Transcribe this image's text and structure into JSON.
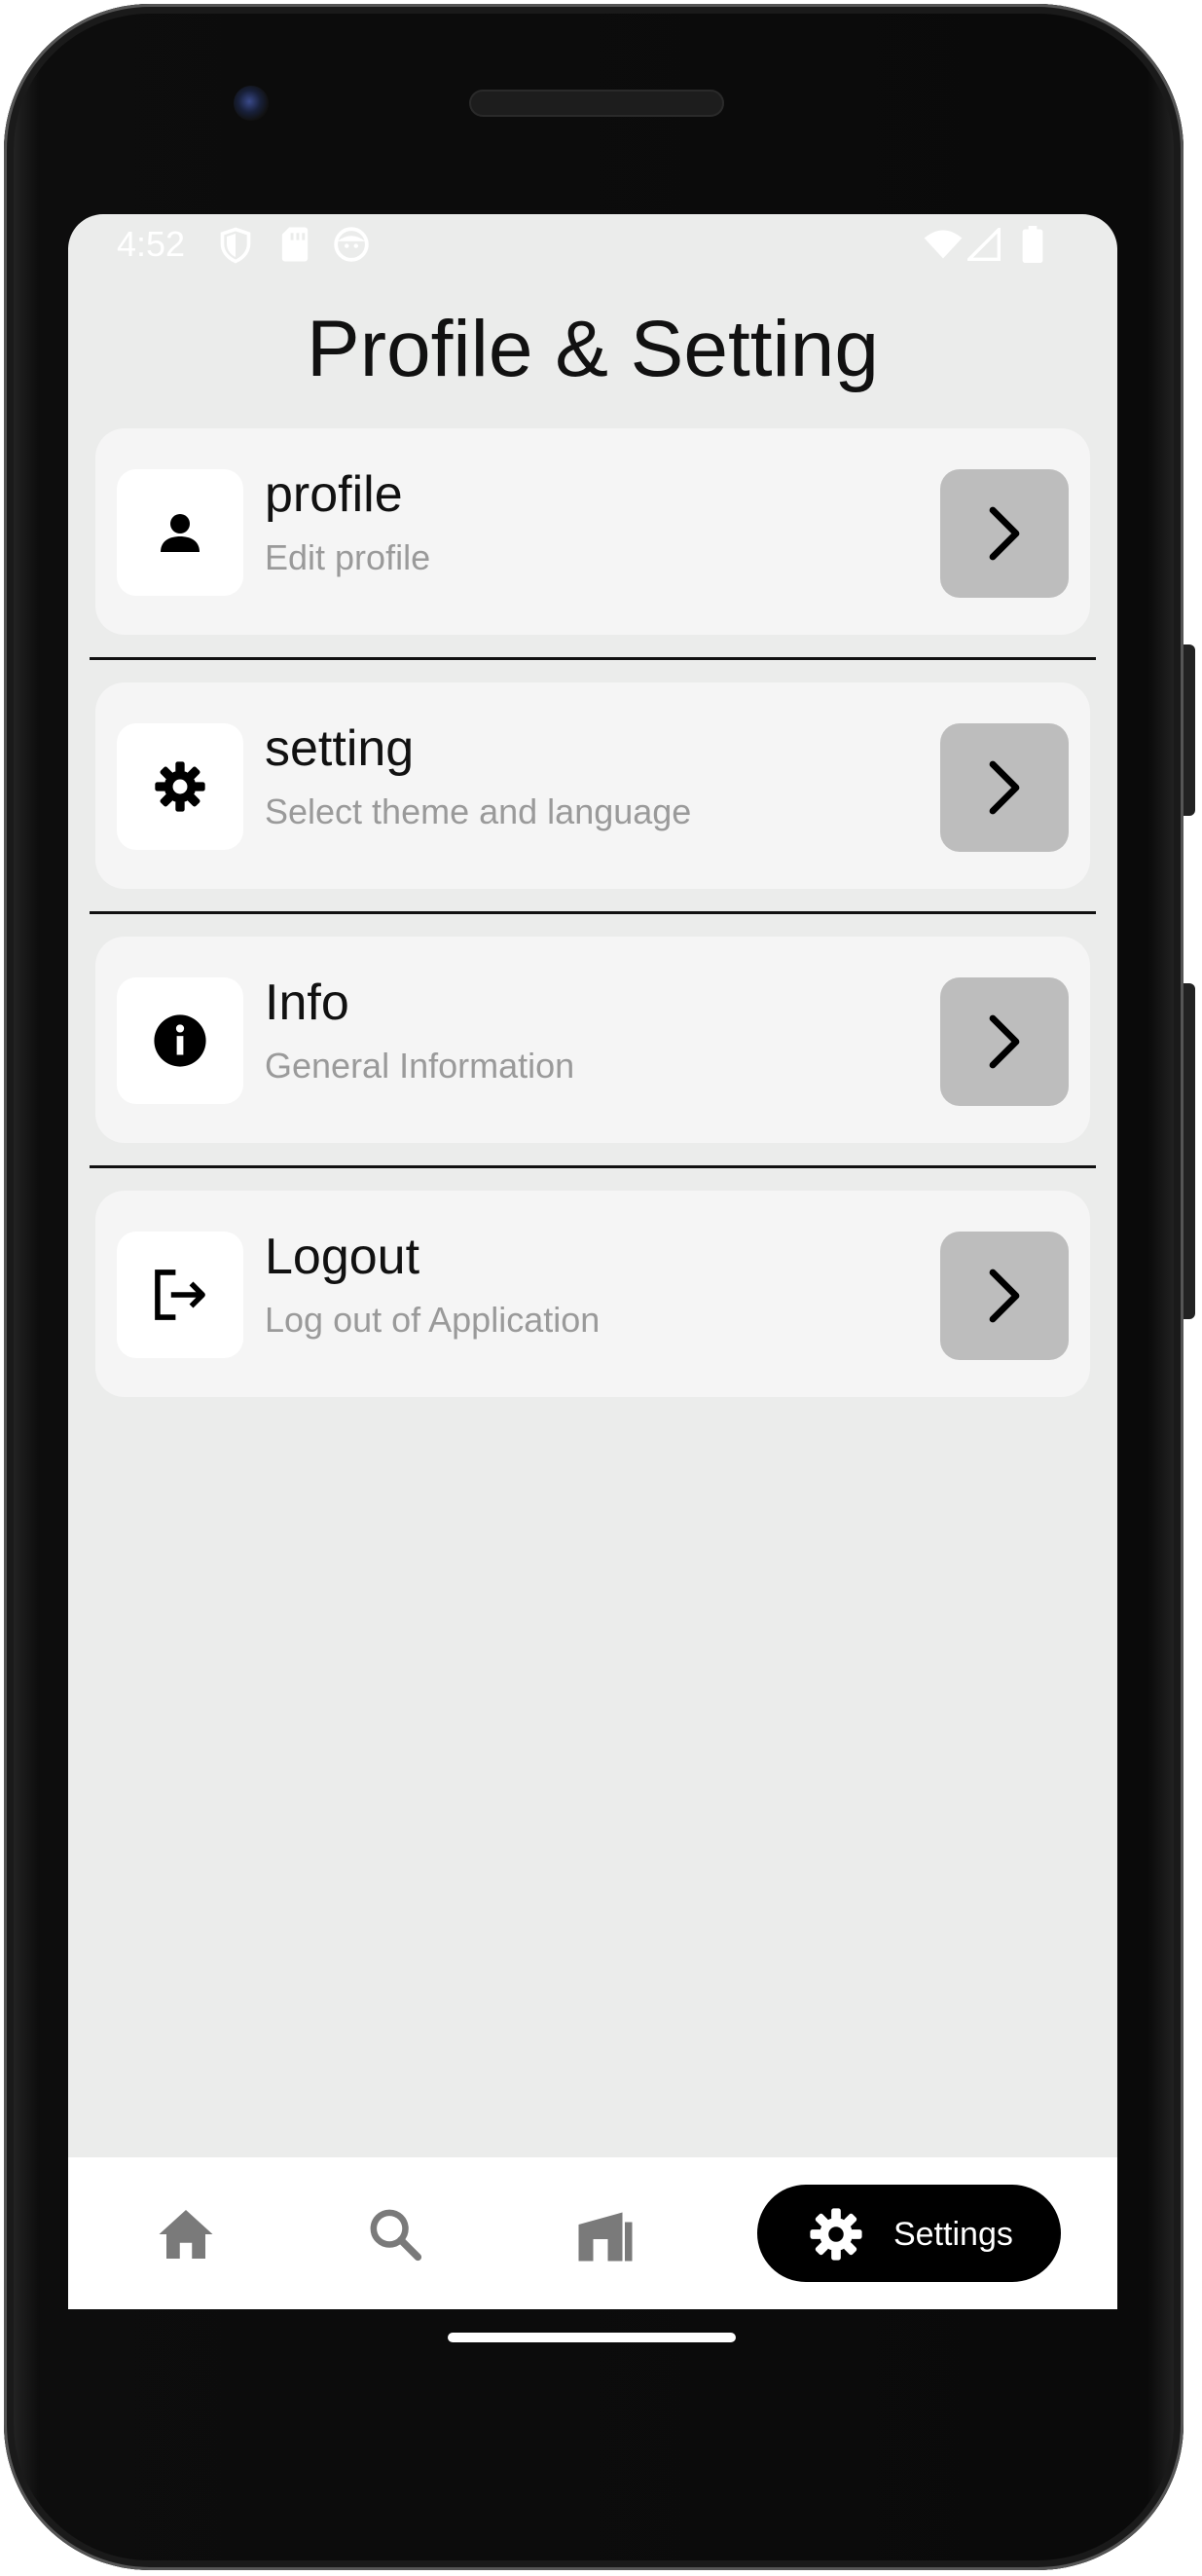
{
  "status_bar": {
    "time": "4:52",
    "icons": [
      "shield-icon",
      "sim-card-icon",
      "smiley-icon",
      "wifi-icon",
      "signal-icon",
      "battery-icon"
    ]
  },
  "page": {
    "title": "Profile & Setting"
  },
  "menu": [
    {
      "title": "profile",
      "subtitle": "Edit profile",
      "icon": "person-icon"
    },
    {
      "title": "setting",
      "subtitle": "Select theme and language",
      "icon": "gear-icon"
    },
    {
      "title": "Info",
      "subtitle": "General Information",
      "icon": "info-icon"
    },
    {
      "title": "Logout",
      "subtitle": "Log out of Application",
      "icon": "logout-icon"
    }
  ],
  "bottom_nav": {
    "items": [
      {
        "icon": "home-icon"
      },
      {
        "icon": "search-icon"
      },
      {
        "icon": "store-icon"
      },
      {
        "icon": "gear-icon",
        "label": "Settings",
        "active": true
      }
    ]
  },
  "colors": {
    "screen_bg": "#ebeceb",
    "card_bg": "#f5f5f5",
    "chevron_button": "#bdbdbd",
    "active_nav": "#000000",
    "inactive_nav_icon": "#7a7a7a"
  }
}
